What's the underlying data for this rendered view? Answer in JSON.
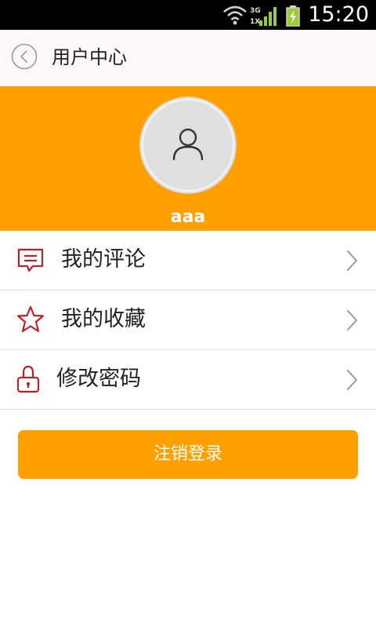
{
  "status_bar": {
    "time": "15:20",
    "network_label_top": "3G",
    "network_label_bottom": "1X",
    "icons": [
      "wifi-icon",
      "signal-icon",
      "battery-charging-icon"
    ]
  },
  "header": {
    "back_icon": "chevron-left-circle-icon",
    "title": "用户中心"
  },
  "profile": {
    "background_color": "#ffa000",
    "avatar_icon": "user-icon",
    "username": "aaa"
  },
  "menu": {
    "items": [
      {
        "icon": "comment-icon",
        "label": "我的评论"
      },
      {
        "icon": "star-icon",
        "label": "我的收藏"
      },
      {
        "icon": "lock-icon",
        "label": "修改密码"
      }
    ],
    "icon_color": "#c0202c",
    "chevron_icon": "chevron-right-icon"
  },
  "logout": {
    "label": "注销登录",
    "color": "#ffa000"
  }
}
